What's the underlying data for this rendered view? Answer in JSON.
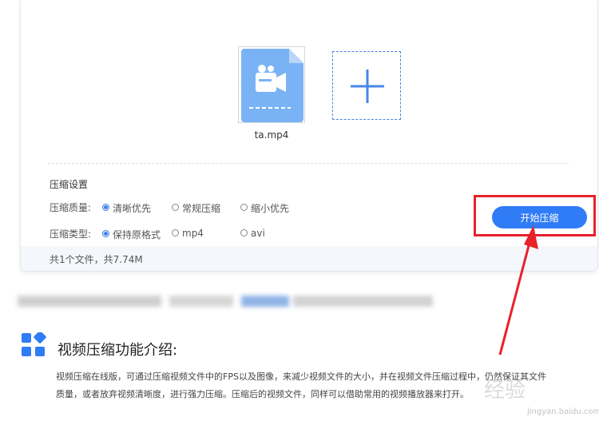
{
  "upload": {
    "file_name": "ta.mp4",
    "file_icon": "video-file-icon",
    "add_icon": "plus-icon"
  },
  "settings": {
    "title": "压缩设置",
    "quality": {
      "label": "压缩质量:",
      "options": [
        "清晰优先",
        "常规压缩",
        "缩小优先"
      ],
      "selected": "清晰优先"
    },
    "format": {
      "label": "压缩类型:",
      "options": [
        "保持原格式",
        "mp4",
        "avi"
      ],
      "selected": "保持原格式"
    }
  },
  "summary": "共1个文件，共7.74M",
  "start_button": "开始压缩",
  "intro": {
    "title": "视频压缩功能介绍:",
    "text_line1": "视频压缩在线版，可通过压缩视频文件中的FPS以及图像，来减少视频文件的大小，并在视频文件压缩过程中，仍然保证其文件",
    "text_line2": "质量，或者放弃视频清晰度，进行强力压缩。压缩后的视频文件，同样可以借助常用的视频播放器来打开。"
  },
  "watermark": {
    "text": "经验",
    "url": "jingyan.baidu.com"
  },
  "colors": {
    "accent": "#2f7cf6",
    "annotation": "#e8212a",
    "file_icon": "#7ab3f5"
  }
}
